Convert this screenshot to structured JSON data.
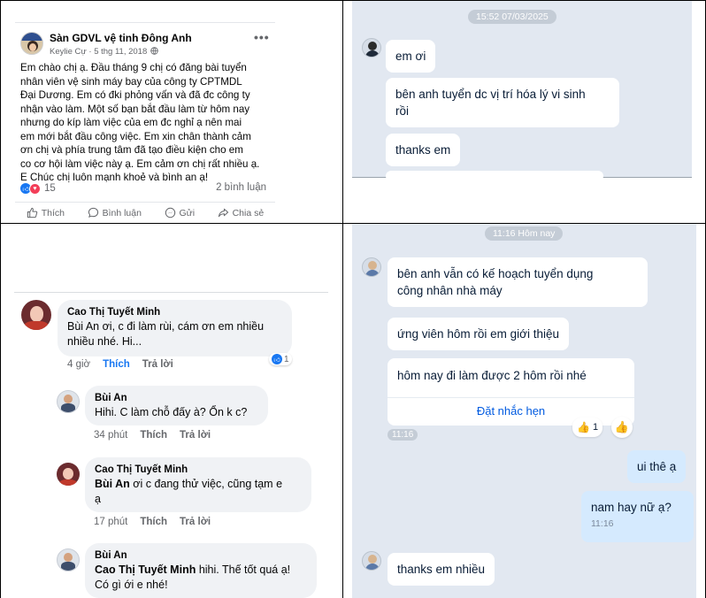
{
  "colors": {
    "facebook_blue": "#1877f2",
    "facebook_meta_gray": "#65676b",
    "zalo_chat_bg": "#e2e8f1",
    "zalo_sent_bubble": "#d5eafe",
    "zalo_link_blue": "#005ae0"
  },
  "fb_post": {
    "page_name": "Sàn GDVL vệ tinh Đông Anh",
    "author": "Keylie Cự",
    "date": "5 thg 11, 2018",
    "meta_separator": " · ",
    "body_lines": [
      "Em chào chị ạ. Đầu tháng 9 chị có đăng bài tuyển",
      "nhân viên vệ sinh máy bay của công ty CPTMDL",
      "Đại Dương. Em có đki phỏng vấn và đã đc công ty",
      "nhận vào làm. Một số bạn bắt đầu làm từ hôm nay",
      "nhưng do kíp làm việc của em đc nghỉ ạ nên mai",
      "em mới bắt đầu công việc. Em xin chân thành cảm",
      "ơn chị và phía trung tâm đã tạo điều kiện cho em",
      "co cơ hội làm việc này ạ. Em cảm ơn chị rất nhiều ạ.",
      "E Chúc chị luôn mạnh khoẻ và bình an ạ!"
    ],
    "reaction_count": "15",
    "comment_count": "2 bình luận",
    "actions": {
      "like": "Thích",
      "comment": "Bình luận",
      "send": "Gửi",
      "share": "Chia sẻ"
    }
  },
  "chat_top": {
    "timestamp": "15:52 07/03/2025",
    "messages": [
      "em ơi",
      "bên anh tuyển dc vị trí hóa lý vi sinh",
      "rồi",
      "thanks em"
    ]
  },
  "fb_comments": [
    {
      "name": "Cao Thị Tuyết Minh",
      "text_lines": [
        "Bùi An ơi, c đi làm rùi, cám ơn em nhiều",
        "nhiều nhé. Hi..."
      ],
      "time": "4 giờ",
      "like_label": "Thích",
      "reply_label": "Trả lời",
      "reaction_count": "1"
    },
    {
      "name": "Bùi An",
      "text_lines": [
        "Hihi. C làm chỗ đấy à? Ổn k c?"
      ],
      "time": "34 phút",
      "like_label": "Thích",
      "reply_label": "Trả lời"
    },
    {
      "name": "Cao Thị Tuyết Minh",
      "mention": "Bùi An",
      "text_lines": [
        " ơi c đang thử việc, cũng tạm e",
        "ạ"
      ],
      "time": "17 phút",
      "like_label": "Thích",
      "reply_label": "Trả lời"
    },
    {
      "name": "Bùi An",
      "mention": "Cao Thị Tuyết Minh",
      "text_lines": [
        " hihi. Thế tốt quá ạ!",
        "Có gì ới e nhé!"
      ]
    }
  ],
  "chat_bottom": {
    "timestamp": "11:16 Hôm nay",
    "received": [
      "bên anh vẫn có kế hoạch tuyển dụng",
      "công nhân nhà máy",
      "ứng viên hôm rồi em giới thiệu",
      "hôm nay đi làm được 2 hôm rồi nhé"
    ],
    "reminder_label": "Đặt nhắc hẹn",
    "reaction_count": "1",
    "received_time": "11:16",
    "sent": [
      "ui thê ạ",
      "nam hay nữ ạ?"
    ],
    "sent_time": "11:16",
    "last_received": "thanks em nhiều",
    "icons": [
      "thumbs-up-icon"
    ]
  }
}
